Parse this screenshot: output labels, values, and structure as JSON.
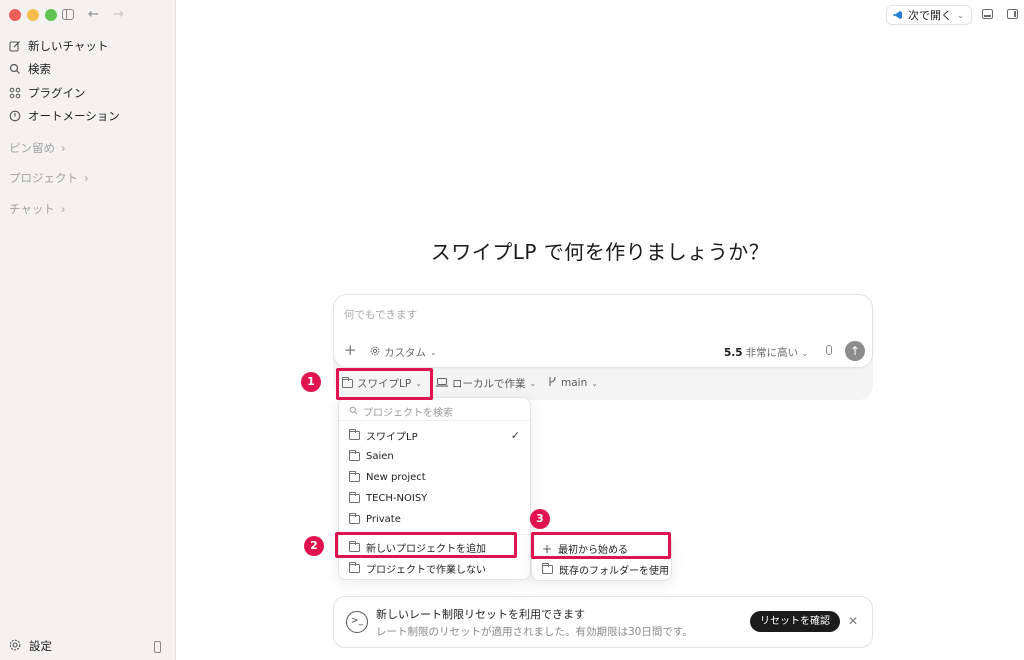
{
  "sidebar": {
    "nav": [
      {
        "label": "新しいチャット",
        "icon": "edit-icon"
      },
      {
        "label": "検索",
        "icon": "search-icon"
      },
      {
        "label": "プラグイン",
        "icon": "grid-icon"
      },
      {
        "label": "オートメーション",
        "icon": "clock-icon"
      }
    ],
    "sections": [
      "ピン留め",
      "プロジェクト",
      "チャット"
    ],
    "settings_label": "設定"
  },
  "header": {
    "open_in_label": "次で開く"
  },
  "main": {
    "title": "スワイプLP で何を作りましょうか？",
    "composer": {
      "placeholder": "何でもできます",
      "custom_label": "カスタム",
      "model_version": "5.5",
      "model_effort": "非常に高い"
    },
    "sub_bar": {
      "project": "スワイプLP",
      "env": "ローカルで作業",
      "branch": "main"
    }
  },
  "project_dropdown": {
    "search_placeholder": "プロジェクトを検索",
    "items": [
      "スワイプLP",
      "Saien",
      "New project",
      "TECH-NOISY",
      "Private"
    ],
    "selected_index": 0,
    "add_project": "新しいプロジェクトを追加",
    "no_project": "プロジェクトで作業しない"
  },
  "submenu": {
    "start_fresh": "最初から始める",
    "use_existing": "既存のフォルダーを使用"
  },
  "annotations": {
    "badge1": "1",
    "badge2": "2",
    "badge3": "3",
    "highlight_color": "#e0134e"
  },
  "notice": {
    "title": "新しいレート制限リセットを利用できます",
    "subtitle": "レート制限のリセットが適用されました。有効期限は30日間です。",
    "button": "リセットを確認"
  }
}
